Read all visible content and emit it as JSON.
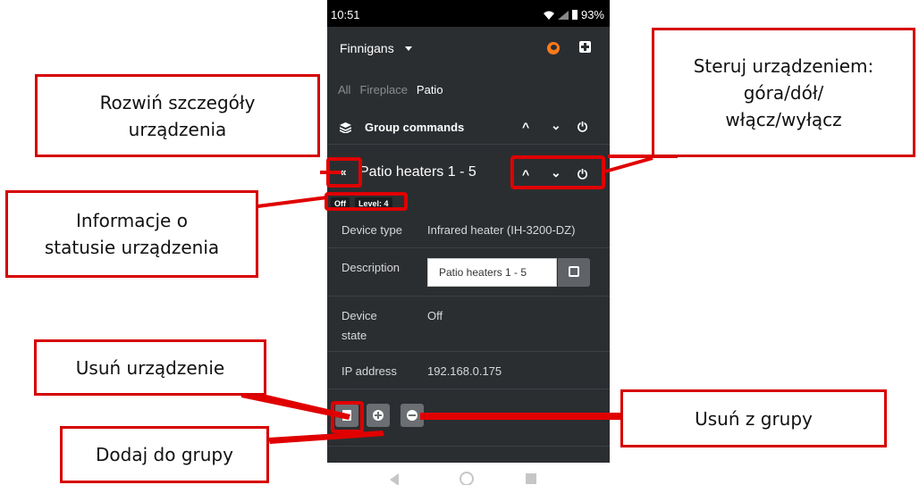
{
  "status_bar": {
    "time": "10:51",
    "battery": "93%"
  },
  "app": {
    "location": "Finnigans",
    "tabs": [
      {
        "label": "All",
        "active": false
      },
      {
        "label": "Fireplace",
        "active": false
      },
      {
        "label": "Patio",
        "active": true
      }
    ],
    "group_commands": {
      "label": "Group commands",
      "up": "^",
      "down": "⌄",
      "power": "⏻"
    },
    "device": {
      "title": "Patio heaters 1 - 5",
      "badges": [
        "Off",
        "Level: 4"
      ],
      "rows": [
        {
          "key": "Device type",
          "value": "Infrared heater (IH-3200-DZ)"
        },
        {
          "key": "Description",
          "value": ""
        },
        {
          "key": "Device state",
          "value": "Off"
        },
        {
          "key": "IP address",
          "value": "192.168.0.175"
        }
      ],
      "description_value": "Patio heaters 1 - 5",
      "device_state_key_line1": "Device",
      "device_state_key_line2": "state"
    }
  },
  "callouts": {
    "expand": "Rozwiń szczegóły urządzenia",
    "expand_l1": "Rozwiń szczegóły",
    "expand_l2": "urządzenia",
    "status_l1": "Informacje o",
    "status_l2": "statusie urządzenia",
    "control_l1": "Steruj urządzeniem:",
    "control_l2": "góra/dół/",
    "control_l3": "włącz/wyłącz",
    "delete": "Usuń urządzenie",
    "add_group": "Dodaj do grupy",
    "remove_group": "Usuń z grupy"
  },
  "colors": {
    "highlight": "#e00000",
    "app_bg": "#2b2e31"
  }
}
